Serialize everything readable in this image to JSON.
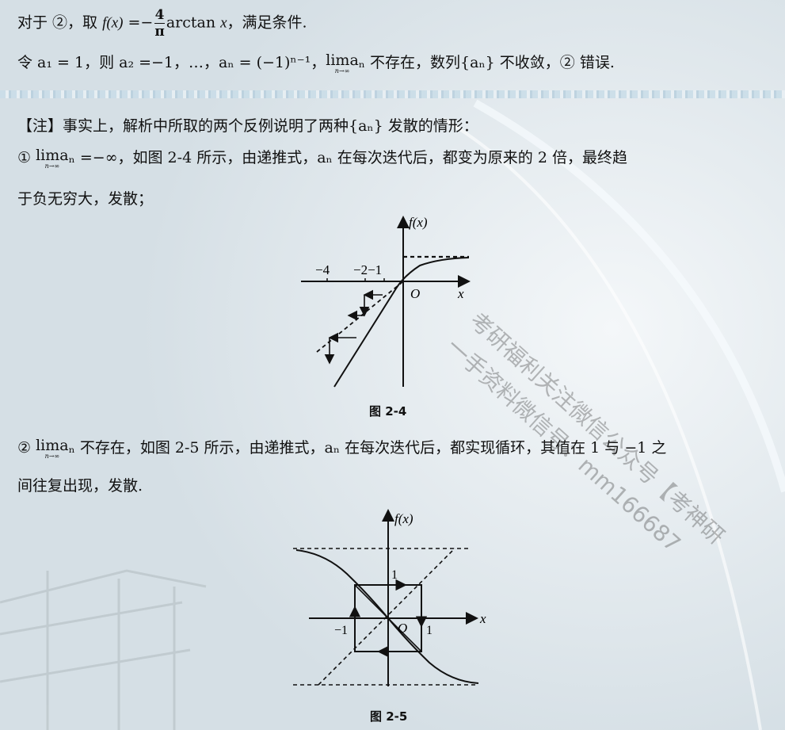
{
  "text": {
    "line1_prefix": "对于 ②，取 ",
    "line1_fx": "f(x)",
    "line1_eq": " =−",
    "line1_num": "4",
    "line1_den": "π",
    "line1_arctan": "arctan ",
    "line1_x": "x",
    "line1_suffix": "，满足条件.",
    "line2_a": "令 a₁ = 1，则 a₂ =−1，…，aₙ = (−1)ⁿ⁻¹，",
    "line2_lim": "lima",
    "line2_lim_sub": "n→∞",
    "line2_b": "ₙ 不存在，数列{aₙ} 不收敛，② 错误.",
    "note_line1": "【注】事实上，解析中所取的两个反例说明了两种{aₙ} 发散的情形：",
    "note_line2_a": "①",
    "note_line2_lim": "lima",
    "note_line2_lim_sub": "n→∞",
    "note_line2_b": "ₙ =−∞，如图 2-4 所示，由递推式，aₙ 在每次迭代后，都变为原来的 2 倍，最终趋",
    "note_line3": "于负无穷大，发散；",
    "note_line4_a": "②",
    "note_line4_lim": "lima",
    "note_line4_lim_sub": "n→∞",
    "note_line4_b": "ₙ 不存在，如图 2-5 所示，由递推式，aₙ 在每次迭代后，都实现循环，其值在 1 与 −1 之",
    "note_line5": "间往复出现，发散."
  },
  "figure1": {
    "caption": "图 2-4",
    "ylabel": "f(x)",
    "xlabel": "x",
    "origin": "O",
    "tick_m4": "−4",
    "tick_m2m1": "−2−1"
  },
  "figure2": {
    "caption": "图 2-5",
    "ylabel": "f(x)",
    "xlabel": "x",
    "origin": "O",
    "tick_p1_y": "1",
    "tick_m1_x": "−1",
    "tick_p1_x": "1"
  },
  "watermark": {
    "line1": "考研福利关注微信公众号【考神研",
    "line2": "一手资料微信号：mm166687"
  }
}
